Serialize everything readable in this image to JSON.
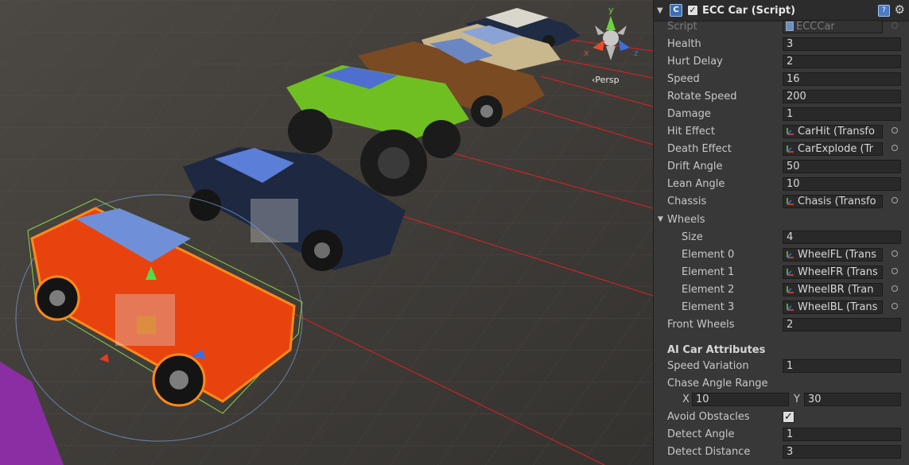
{
  "scene": {
    "persp_label": "‹Persp",
    "gizmo_axes": {
      "x": "x",
      "y": "y",
      "z": "z"
    }
  },
  "inspector": {
    "header": {
      "title": "ECC Car (Script)",
      "enabled": true,
      "icon": "csharp-script-icon"
    },
    "script": {
      "label": "Script",
      "value": "ECCCar"
    },
    "fields": [
      {
        "label": "Health",
        "value": "3"
      },
      {
        "label": "Hurt Delay",
        "value": "2"
      },
      {
        "label": "Speed",
        "value": "16"
      },
      {
        "label": "Rotate Speed",
        "value": "200"
      },
      {
        "label": "Damage",
        "value": "1"
      },
      {
        "label": "Hit Effect",
        "value": "CarHit (Transfo"
      },
      {
        "label": "Death Effect",
        "value": "CarExplode (Tr"
      },
      {
        "label": "Drift Angle",
        "value": "50"
      },
      {
        "label": "Lean Angle",
        "value": "10"
      },
      {
        "label": "Chassis",
        "value": "Chasis (Transfo"
      }
    ],
    "wheels": {
      "label": "Wheels",
      "size_label": "Size",
      "size": "4",
      "elements": [
        {
          "label": "Element 0",
          "value": "WheelFL (Trans"
        },
        {
          "label": "Element 1",
          "value": "WheelFR (Trans"
        },
        {
          "label": "Element 2",
          "value": "WheelBR (Tran"
        },
        {
          "label": "Element 3",
          "value": "WheelBL (Trans"
        }
      ]
    },
    "front_wheels": {
      "label": "Front Wheels",
      "value": "2"
    },
    "ai_section": "AI Car Attributes",
    "speed_variation": {
      "label": "Speed Variation",
      "value": "1"
    },
    "chase_angle_range": {
      "label": "Chase Angle Range",
      "x_label": "X",
      "x": "10",
      "y_label": "Y",
      "y": "30"
    },
    "avoid_obstacles": {
      "label": "Avoid Obstacles",
      "checked": true
    },
    "detect_angle": {
      "label": "Detect Angle",
      "value": "1"
    },
    "detect_distance": {
      "label": "Detect Distance",
      "value": "3"
    }
  },
  "colors": {
    "inspector_bg": "#383838",
    "field_bg": "#292929",
    "selection_outline": "#ff7a00",
    "gizmo_red": "#e84a2d",
    "gizmo_green": "#6ad33c",
    "gizmo_blue": "#3a6fe0"
  }
}
